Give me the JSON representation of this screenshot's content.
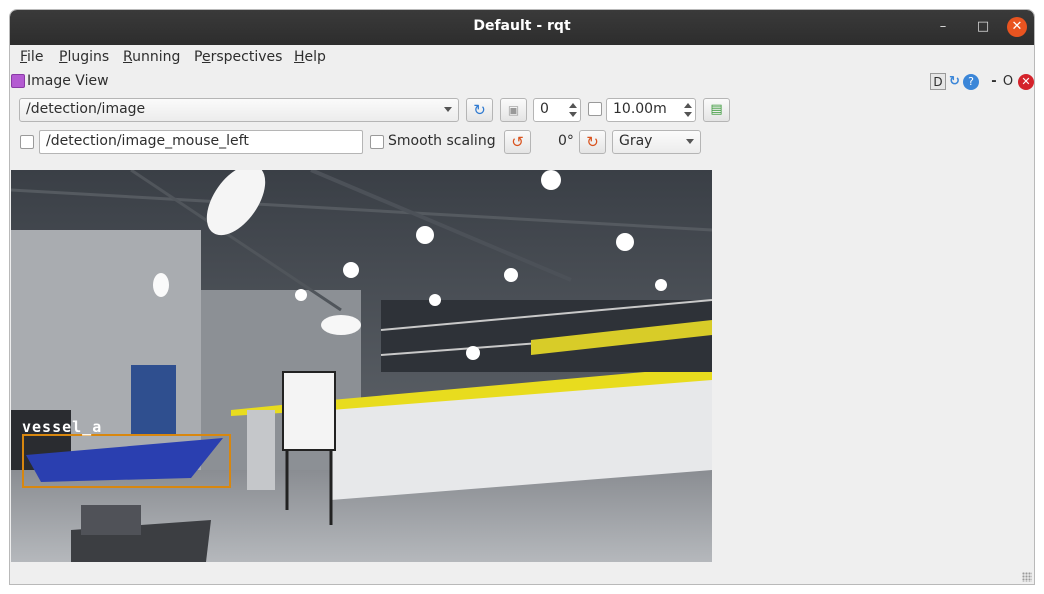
{
  "window": {
    "title": "Default - rqt"
  },
  "menu": [
    "File",
    "Plugins",
    "Running",
    "Perspectives",
    "Help"
  ],
  "menu_mnemonics": [
    "F",
    "P",
    "R",
    "e",
    "H"
  ],
  "dock": {
    "title": "Image View",
    "d_label": "D",
    "min_label": "-",
    "float_label": "O"
  },
  "toolbar": {
    "topic": "/detection/image",
    "spin_value": "0",
    "duration": "10.00m",
    "mouse_topic": "/detection/image_mouse_left",
    "smooth_scaling_label": "Smooth scaling",
    "rotation": "0°",
    "color_scheme": "Gray"
  },
  "overlay": {
    "label": "vessel_a"
  },
  "icons": {
    "refresh": "refresh-icon",
    "dynamic_range": "dynamic-range-icon",
    "save": "save-image-icon",
    "rotate_left": "rotate-left-icon",
    "rotate_right": "rotate-right-icon"
  }
}
